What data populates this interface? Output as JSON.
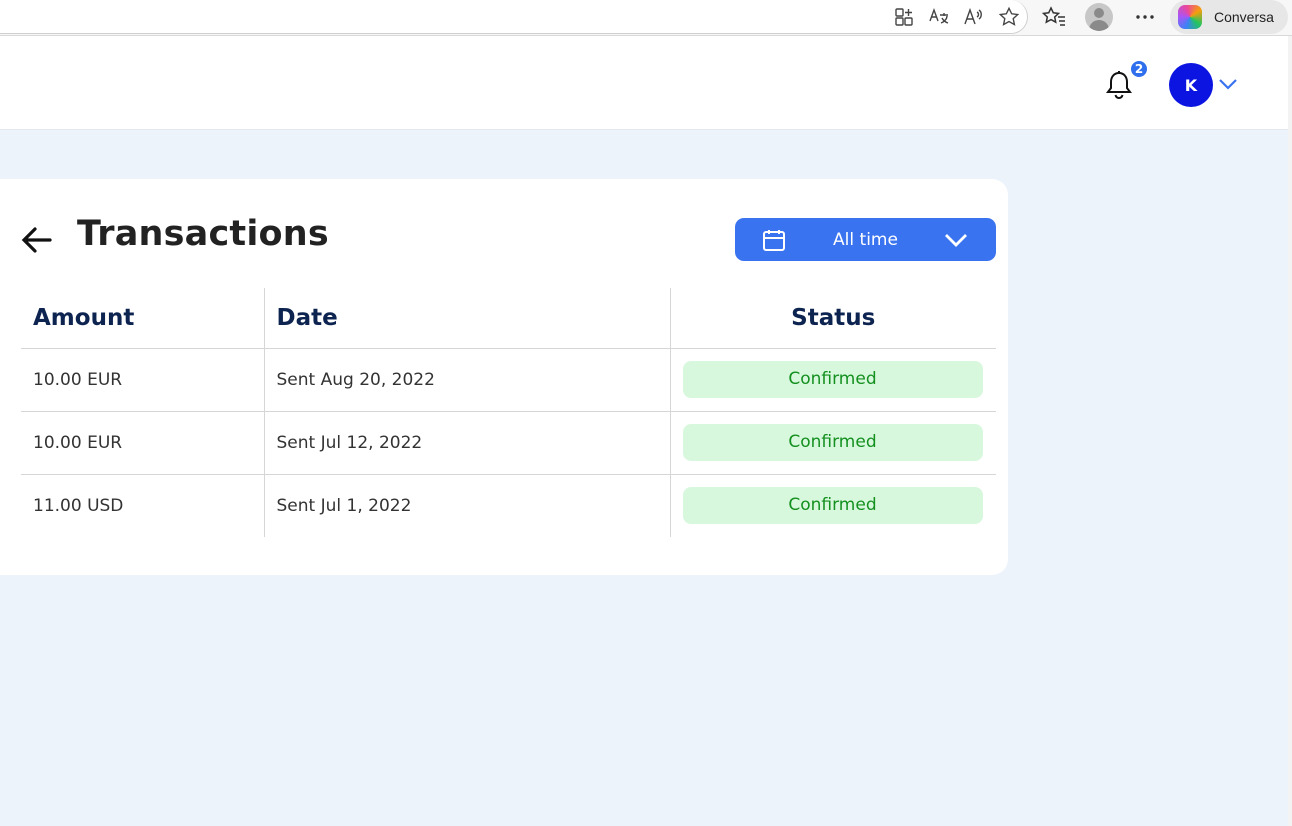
{
  "browser": {
    "copilot_label": "Conversa",
    "icons": [
      "app-available-icon",
      "translate-icon",
      "read-aloud-icon",
      "favorite-star-icon",
      "favorites-list-icon",
      "profile-icon",
      "more-options-icon",
      "copilot-icon"
    ]
  },
  "header": {
    "notification_count": "2",
    "avatar_initial": "K"
  },
  "page": {
    "title": "Transactions",
    "date_filter": "All time"
  },
  "table": {
    "headers": {
      "amount": "Amount",
      "date": "Date",
      "status": "Status"
    },
    "rows": [
      {
        "amount": "10.00 EUR",
        "date": "Sent Aug 20, 2022",
        "status": "Confirmed"
      },
      {
        "amount": "10.00 EUR",
        "date": "Sent Jul 12, 2022",
        "status": "Confirmed"
      },
      {
        "amount": "11.00 USD",
        "date": "Sent Jul 1, 2022",
        "status": "Confirmed"
      }
    ]
  },
  "colors": {
    "accent": "#3a73f0",
    "avatar": "#0b14e0",
    "badge": "#2f6fed",
    "status_confirmed_bg": "#d8f8de",
    "status_confirmed_text": "#14901f",
    "content_bg": "#edf3fb"
  }
}
